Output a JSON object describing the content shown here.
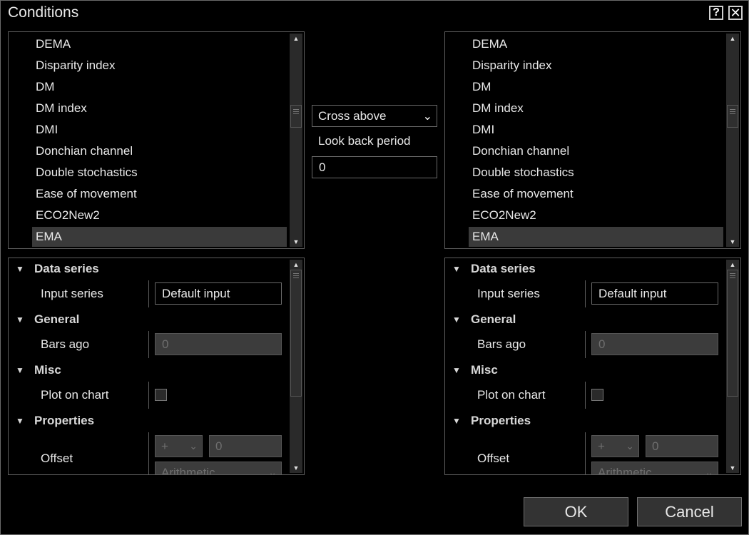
{
  "window": {
    "title": "Conditions",
    "help_label": "?",
    "close_label": "✕"
  },
  "left_list": {
    "items": [
      "DEMA",
      "Disparity index",
      "DM",
      "DM index",
      "DMI",
      "Donchian channel",
      "Double stochastics",
      "Ease of movement",
      "ECO2New2",
      "EMA"
    ],
    "selected": "EMA"
  },
  "right_list": {
    "items": [
      "DEMA",
      "Disparity index",
      "DM",
      "DM index",
      "DMI",
      "Donchian channel",
      "Double stochastics",
      "Ease of movement",
      "ECO2New2",
      "EMA"
    ],
    "selected": "EMA"
  },
  "middle": {
    "operator": "Cross above",
    "lookback_label": "Look back period",
    "lookback_value": "0"
  },
  "left_props": {
    "data_series": "Data series",
    "input_series_label": "Input series",
    "input_series_value": "Default input",
    "general": "General",
    "bars_ago_label": "Bars ago",
    "bars_ago_value": "0",
    "misc": "Misc",
    "plot_on_chart_label": "Plot on chart",
    "properties": "Properties",
    "offset_label": "Offset",
    "offset_sign": "+",
    "offset_value": "0",
    "offset_type": "Arithmetic"
  },
  "right_props": {
    "data_series": "Data series",
    "input_series_label": "Input series",
    "input_series_value": "Default input",
    "general": "General",
    "bars_ago_label": "Bars ago",
    "bars_ago_value": "0",
    "misc": "Misc",
    "plot_on_chart_label": "Plot on chart",
    "properties": "Properties",
    "offset_label": "Offset",
    "offset_sign": "+",
    "offset_value": "0",
    "offset_type": "Arithmetic"
  },
  "buttons": {
    "ok": "OK",
    "cancel": "Cancel"
  }
}
